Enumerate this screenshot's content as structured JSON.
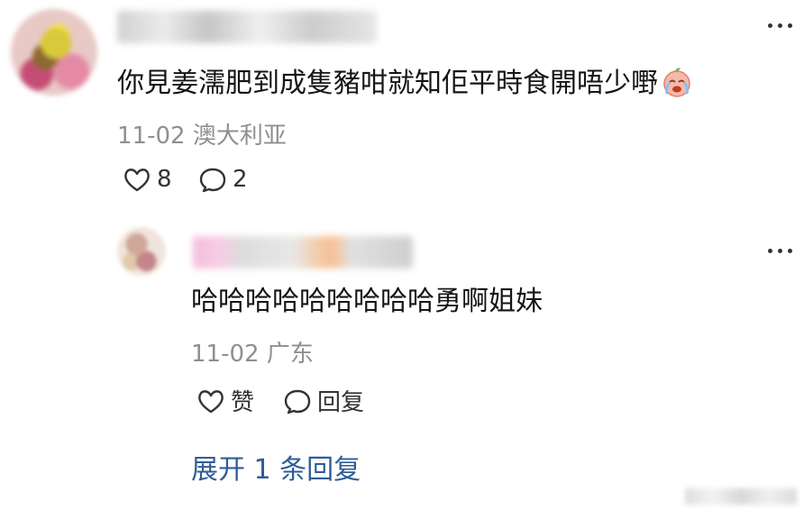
{
  "comment": {
    "content": "你見姜濡肥到成隻豬咁就知佢平時食開唔少嘢",
    "emoji_icon": "crying-face-emoji-icon",
    "date": "11-02",
    "location": "澳大利亚",
    "like_count": "8",
    "comment_count": "2"
  },
  "reply": {
    "content": "哈哈哈哈哈哈哈哈哈勇啊姐妹",
    "date": "11-02",
    "location": "广东",
    "like_label": "赞",
    "reply_label": "回复"
  },
  "expand_replies_label": "展开 1 条回复",
  "colors": {
    "link": "#2f5c95",
    "meta_gray": "#8f8f8f",
    "text": "#151515"
  }
}
